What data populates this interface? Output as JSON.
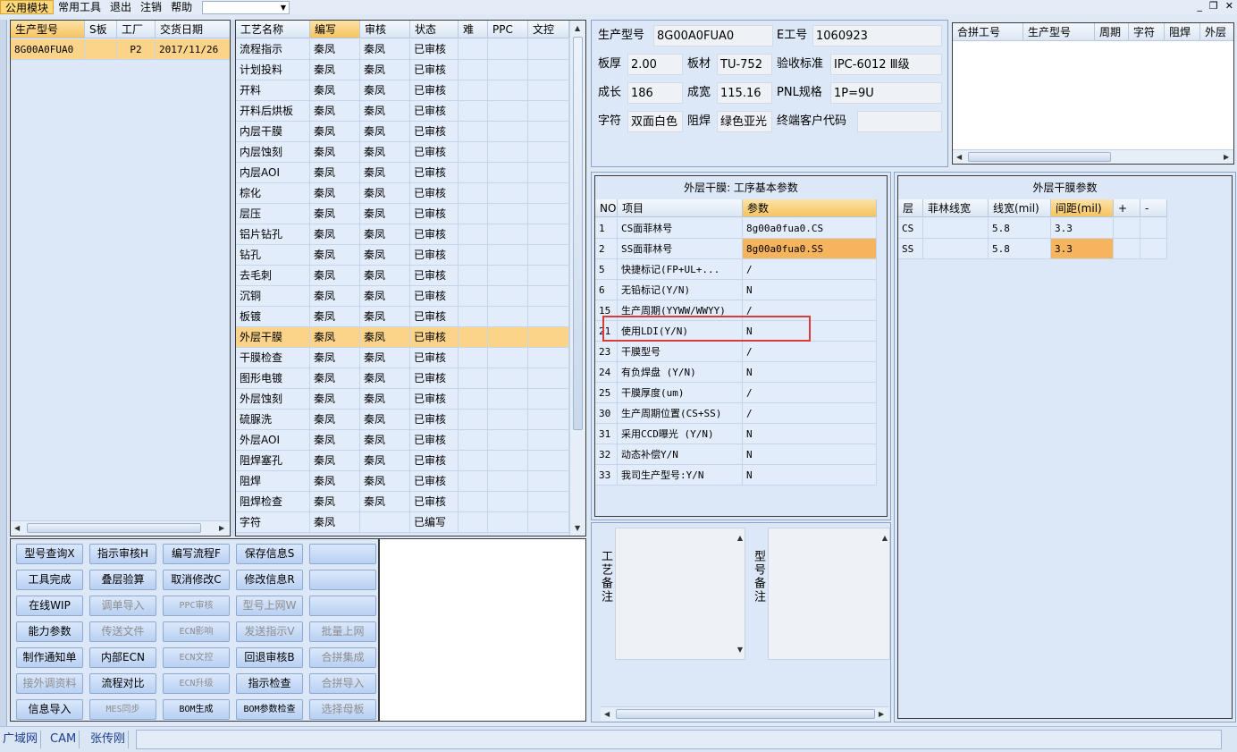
{
  "menubar": {
    "items": [
      "公用模块",
      "常用工具",
      "退出",
      "注销",
      "帮助"
    ],
    "combo_value": ""
  },
  "model_list": {
    "headers": [
      "生产型号",
      "S板",
      "工厂",
      "交货日期"
    ],
    "rows": [
      [
        "8G00A0FUA0",
        "",
        "P2",
        "2017/11/26"
      ]
    ]
  },
  "process_table": {
    "headers": [
      "工艺名称",
      "编写",
      "审核",
      "状态",
      "难",
      "PPC",
      "文控"
    ],
    "rows": [
      [
        "流程指示",
        "秦凤",
        "秦凤",
        "已审核"
      ],
      [
        "计划投料",
        "秦凤",
        "秦凤",
        "已审核"
      ],
      [
        "开料",
        "秦凤",
        "秦凤",
        "已审核"
      ],
      [
        "开料后烘板",
        "秦凤",
        "秦凤",
        "已审核"
      ],
      [
        "内层干膜",
        "秦凤",
        "秦凤",
        "已审核"
      ],
      [
        "内层蚀刻",
        "秦凤",
        "秦凤",
        "已审核"
      ],
      [
        "内层AOI",
        "秦凤",
        "秦凤",
        "已审核"
      ],
      [
        "棕化",
        "秦凤",
        "秦凤",
        "已审核"
      ],
      [
        "层压",
        "秦凤",
        "秦凤",
        "已审核"
      ],
      [
        "铝片钻孔",
        "秦凤",
        "秦凤",
        "已审核"
      ],
      [
        "钻孔",
        "秦凤",
        "秦凤",
        "已审核"
      ],
      [
        "去毛刺",
        "秦凤",
        "秦凤",
        "已审核"
      ],
      [
        "沉铜",
        "秦凤",
        "秦凤",
        "已审核"
      ],
      [
        "板镀",
        "秦凤",
        "秦凤",
        "已审核"
      ],
      [
        "外层干膜",
        "秦凤",
        "秦凤",
        "已审核"
      ],
      [
        "干膜检查",
        "秦凤",
        "秦凤",
        "已审核"
      ],
      [
        "图形电镀",
        "秦凤",
        "秦凤",
        "已审核"
      ],
      [
        "外层蚀刻",
        "秦凤",
        "秦凤",
        "已审核"
      ],
      [
        "硫脲洗",
        "秦凤",
        "秦凤",
        "已审核"
      ],
      [
        "外层AOI",
        "秦凤",
        "秦凤",
        "已审核"
      ],
      [
        "阻焊塞孔",
        "秦凤",
        "秦凤",
        "已审核"
      ],
      [
        "阻焊",
        "秦凤",
        "秦凤",
        "已审核"
      ],
      [
        "阻焊检查",
        "秦凤",
        "秦凤",
        "已审核"
      ],
      [
        "字符",
        "秦凤",
        "",
        "已编写"
      ]
    ],
    "selected_index": 14
  },
  "buttons": [
    [
      "型号查询X",
      "指示审核H",
      "编写流程F",
      "保存信息S",
      ""
    ],
    [
      "工具完成",
      "叠层验算",
      "取消修改C",
      "修改信息R",
      ""
    ],
    [
      "在线WIP",
      "调单导入",
      "PPC审核",
      "型号上网W",
      ""
    ],
    [
      "能力参数",
      "传送文件",
      "ECN影响",
      "发送指示V",
      "批量上网"
    ],
    [
      "制作通知单",
      "内部ECN",
      "ECN文控",
      "回退审核B",
      "合拼集成"
    ],
    [
      "接外调资料",
      "流程对比",
      "ECN升级",
      "指示检查",
      "合拼导入"
    ],
    [
      "信息导入",
      "MES同步",
      "BOM生成",
      "BOM参数检查",
      "选择母板"
    ]
  ],
  "button_disabled": [
    [
      false,
      false,
      false,
      false,
      false
    ],
    [
      false,
      false,
      false,
      false,
      false
    ],
    [
      false,
      true,
      true,
      true,
      false
    ],
    [
      false,
      true,
      true,
      true,
      true
    ],
    [
      false,
      false,
      true,
      false,
      true
    ],
    [
      true,
      false,
      true,
      false,
      true
    ],
    [
      false,
      true,
      false,
      false,
      true
    ]
  ],
  "info": {
    "model_label": "生产型号",
    "model_value": "8G00A0FUA0",
    "e_label": "E工号",
    "e_value": "1060923",
    "thick_label": "板厚",
    "thick_value": "2.00",
    "material_label": "板材",
    "material_value": "TU-752",
    "std_label": "验收标准",
    "std_value": "IPC-6012 Ⅲ级",
    "len_label": "成长",
    "len_value": "186",
    "width_label": "成宽",
    "width_value": "115.16",
    "pnl_label": "PNL规格",
    "pnl_value": "1P=9U",
    "char_label": "字符",
    "char_value": "双面白色",
    "mask_label": "阻焊",
    "mask_value": "绿色亚光",
    "cust_label": "终端客户代码",
    "cust_value": ""
  },
  "merge_table": {
    "headers": [
      "合拼工号",
      "生产型号",
      "周期",
      "字符",
      "阻焊",
      "外层"
    ]
  },
  "basic_params": {
    "title": "外层干膜: 工序基本参数",
    "headers": [
      "NO",
      "项目",
      "参数"
    ],
    "rows": [
      [
        "1",
        "CS面菲林号",
        "8g00a0fua0.CS"
      ],
      [
        "2",
        "SS面菲林号",
        "8g00a0fua0.SS"
      ],
      [
        "5",
        "快捷标记(FP+UL+...",
        "/"
      ],
      [
        "6",
        "无铅标记(Y/N)",
        "N"
      ],
      [
        "15",
        "生产周期(YYWW/WWYY)",
        "/"
      ],
      [
        "21",
        "使用LDI(Y/N)",
        "N"
      ],
      [
        "23",
        "干膜型号",
        "/"
      ],
      [
        "24",
        "有负焊盘 (Y/N)",
        "N"
      ],
      [
        "25",
        "干膜厚度(um)",
        "/"
      ],
      [
        "30",
        "生产周期位置(CS+SS)",
        "/"
      ],
      [
        "31",
        "采用CCD曝光 (Y/N)",
        "N"
      ],
      [
        "32",
        "动态补偿Y/N",
        "N"
      ],
      [
        "33",
        "我司生产型号:Y/N",
        "N"
      ]
    ]
  },
  "film_params": {
    "title": "外层干膜参数",
    "headers": [
      "层",
      "菲林线宽",
      "线宽(mil)",
      "间距(mil)",
      "+",
      "-"
    ],
    "rows": [
      [
        "CS",
        "",
        "5.8",
        "3.3",
        "",
        ""
      ],
      [
        "SS",
        "",
        "5.8",
        "3.3",
        "",
        ""
      ]
    ]
  },
  "remarks": {
    "process_label": "工艺备注",
    "model_label": "型号备注"
  },
  "statusbar": {
    "items": [
      "广域网",
      "CAM",
      "张传刚"
    ]
  }
}
